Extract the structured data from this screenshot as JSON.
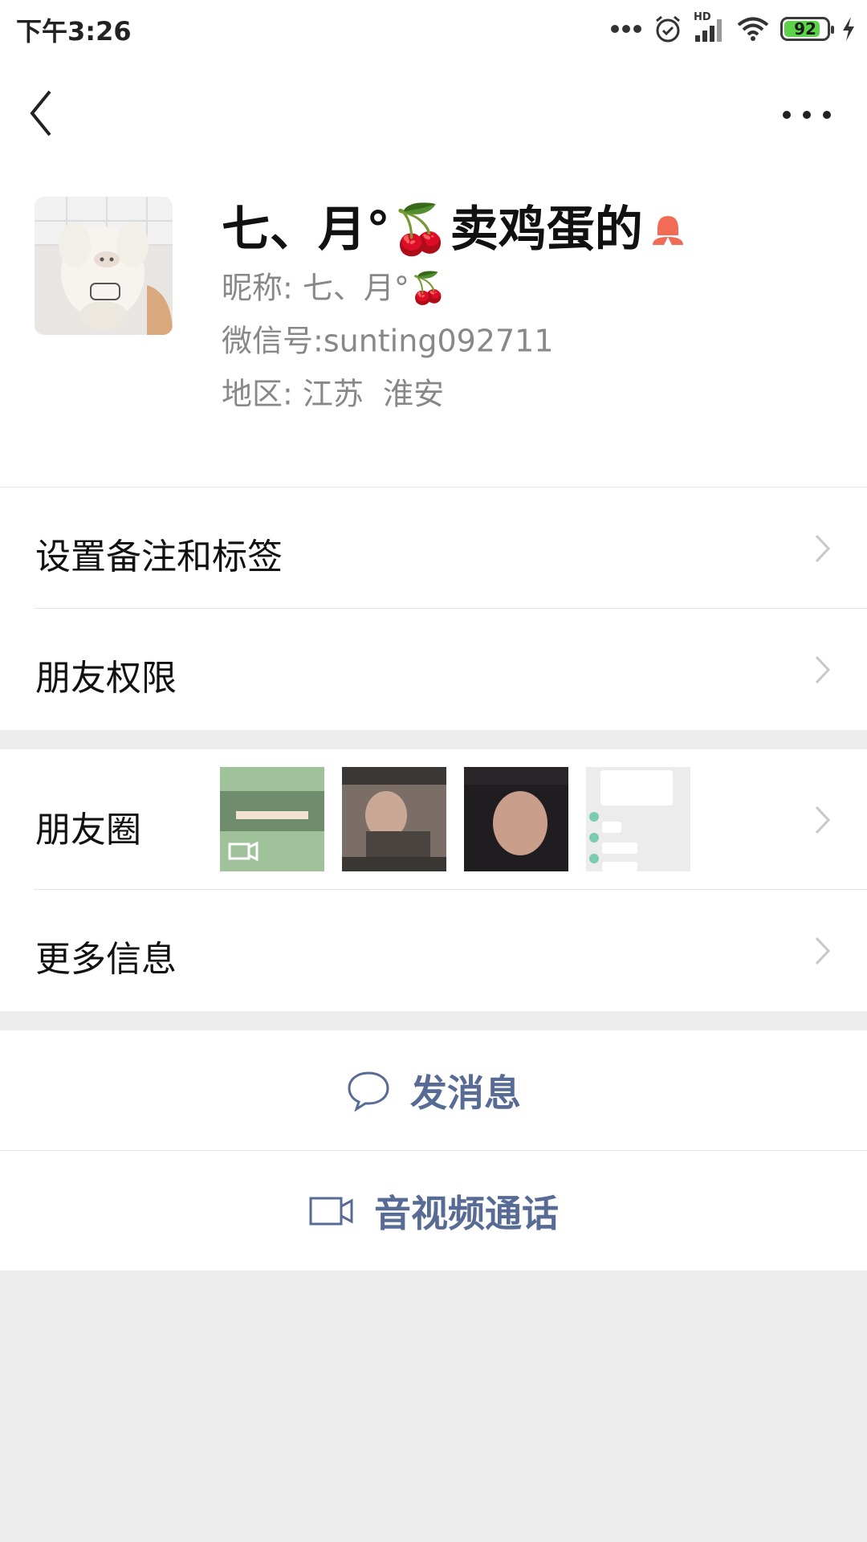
{
  "status_bar": {
    "time": "下午3:26",
    "network_label": "HD",
    "battery": "92"
  },
  "profile": {
    "display_name": "七、月°🍒卖鸡蛋的",
    "nickname_label": "昵称:",
    "nickname_value": "七、月°🍒",
    "wechat_id_label": "微信号:",
    "wechat_id_value": "sunting092711",
    "region_label": "地区:",
    "region_value": "江苏  淮安",
    "gender": "female"
  },
  "menu": {
    "remarks_tags": "设置备注和标签",
    "friend_permissions": "朋友权限",
    "moments": "朋友圈",
    "more_info": "更多信息"
  },
  "actions": {
    "send_message": "发消息",
    "video_call": "音视频通话"
  },
  "colors": {
    "link_blue": "#576b95",
    "battery_green": "#5dd34a",
    "gender_icon": "#f26b55"
  }
}
